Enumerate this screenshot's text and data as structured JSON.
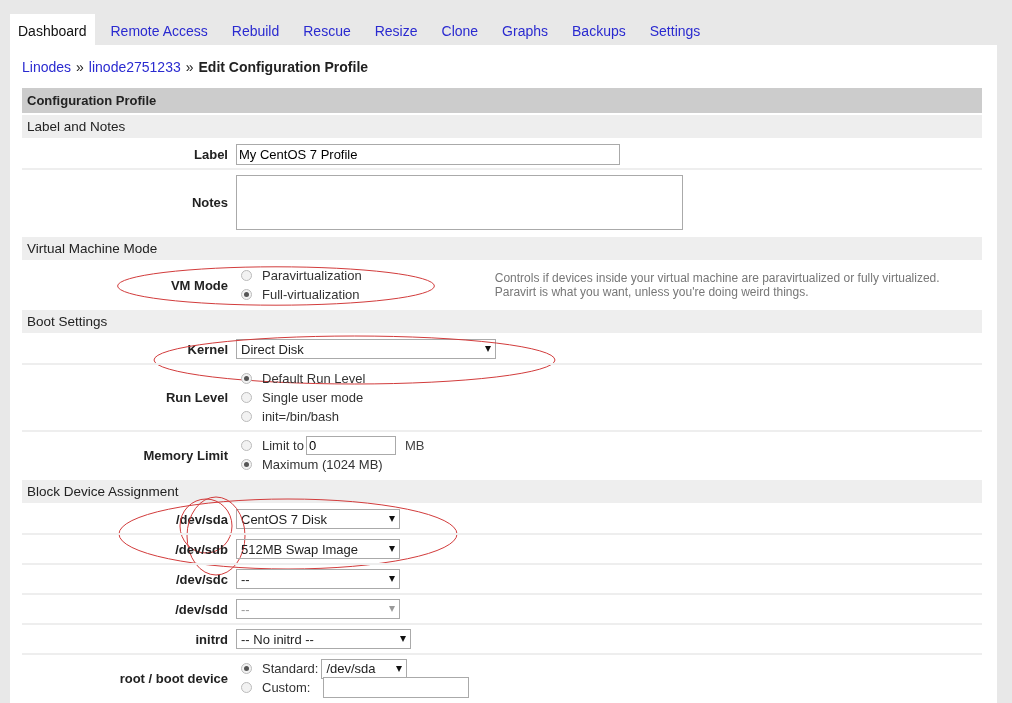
{
  "tabs": [
    {
      "label": "Dashboard",
      "selected": true
    },
    {
      "label": "Remote Access",
      "selected": false
    },
    {
      "label": "Rebuild",
      "selected": false
    },
    {
      "label": "Rescue",
      "selected": false
    },
    {
      "label": "Resize",
      "selected": false
    },
    {
      "label": "Clone",
      "selected": false
    },
    {
      "label": "Graphs",
      "selected": false
    },
    {
      "label": "Backups",
      "selected": false
    },
    {
      "label": "Settings",
      "selected": false
    }
  ],
  "breadcrumb": {
    "links": [
      "Linodes",
      "linode2751233"
    ],
    "separator": "»",
    "current": "Edit Configuration Profile"
  },
  "profile": {
    "title": "Configuration Profile",
    "sections": [
      {
        "title": "Label and Notes",
        "rows": [
          {
            "kind": "text",
            "label": "Label",
            "value": "My CentOS 7 Profile"
          },
          {
            "kind": "textarea",
            "label": "Notes"
          }
        ]
      },
      {
        "title": "Virtual Machine Mode",
        "rows": [
          {
            "kind": "radios",
            "label": "VM Mode",
            "circled": true,
            "note": "Controls if devices inside your virtual machine are paravirtualized or fully virtualized. Paravirt is what you want, unless you're doing weird things.",
            "options": [
              {
                "kind": "plain",
                "label": "Paravirtualization",
                "selected": false
              },
              {
                "kind": "plain",
                "label": "Full-virtualization",
                "selected": true
              }
            ]
          }
        ]
      },
      {
        "title": "Boot Settings",
        "rows": [
          {
            "kind": "dropdown",
            "label": "Kernel",
            "circled": true,
            "value": "Direct Disk",
            "disabled": false
          },
          {
            "kind": "radios",
            "label": "Run Level",
            "options": [
              {
                "kind": "plain",
                "label": "Default Run Level",
                "selected": true
              },
              {
                "kind": "plain",
                "label": "Single user mode",
                "selected": false
              },
              {
                "kind": "plain",
                "label": "init=/bin/bash",
                "selected": false
              }
            ]
          },
          {
            "kind": "radios",
            "label": "Memory Limit",
            "options": [
              {
                "kind": "input",
                "label": "Limit to",
                "value": "0",
                "unit": "MB",
                "selected": false
              },
              {
                "kind": "plain",
                "label": "Maximum (1024 MB)",
                "selected": true
              }
            ]
          }
        ]
      },
      {
        "title": "Block Device Assignment",
        "rows": [
          {
            "kind": "device",
            "label": "/dev/sda",
            "circled": true,
            "value": "CentOS 7 Disk",
            "disabled": false
          },
          {
            "kind": "device",
            "label": "/dev/sdb",
            "circled": true,
            "value": "512MB Swap Image",
            "disabled": false
          },
          {
            "kind": "device",
            "label": "/dev/sdc",
            "value": "--",
            "disabled": false
          },
          {
            "kind": "device",
            "label": "/dev/sdd",
            "value": "--",
            "disabled": true
          },
          {
            "kind": "initrd",
            "label": "initrd",
            "value": "-- No initrd --",
            "disabled": false
          },
          {
            "kind": "radios",
            "label": "root / boot device",
            "options": [
              {
                "kind": "select",
                "label": "Standard:",
                "value": "/dev/sda",
                "selected": true
              },
              {
                "kind": "input",
                "label": "Custom:",
                "selected": false
              }
            ]
          }
        ]
      }
    ]
  }
}
